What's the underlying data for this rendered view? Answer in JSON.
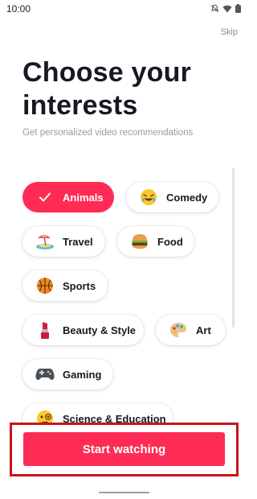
{
  "status_bar": {
    "time": "10:00"
  },
  "header": {
    "skip_label": "Skip",
    "title": "Choose your interests",
    "subtitle": "Get personalized video recommendations"
  },
  "interests": [
    {
      "label": "Animals",
      "icon": "check-icon",
      "selected": true
    },
    {
      "label": "Comedy",
      "icon": "laughing-emoji-icon",
      "selected": false
    },
    {
      "label": "Travel",
      "icon": "beach-umbrella-icon",
      "selected": false
    },
    {
      "label": "Food",
      "icon": "hamburger-icon",
      "selected": false
    },
    {
      "label": "Sports",
      "icon": "basketball-icon",
      "selected": false
    },
    {
      "label": "Beauty & Style",
      "icon": "lipstick-icon",
      "selected": false
    },
    {
      "label": "Art",
      "icon": "palette-icon",
      "selected": false
    },
    {
      "label": "Gaming",
      "icon": "game-controller-icon",
      "selected": false
    },
    {
      "label": "Science & Education",
      "icon": "monocle-face-icon",
      "selected": false
    }
  ],
  "cta": {
    "label": "Start watching"
  },
  "colors": {
    "accent": "#fe2c55",
    "highlight_border": "#c8161d",
    "text": "#161823",
    "muted": "#9a9ba1"
  }
}
